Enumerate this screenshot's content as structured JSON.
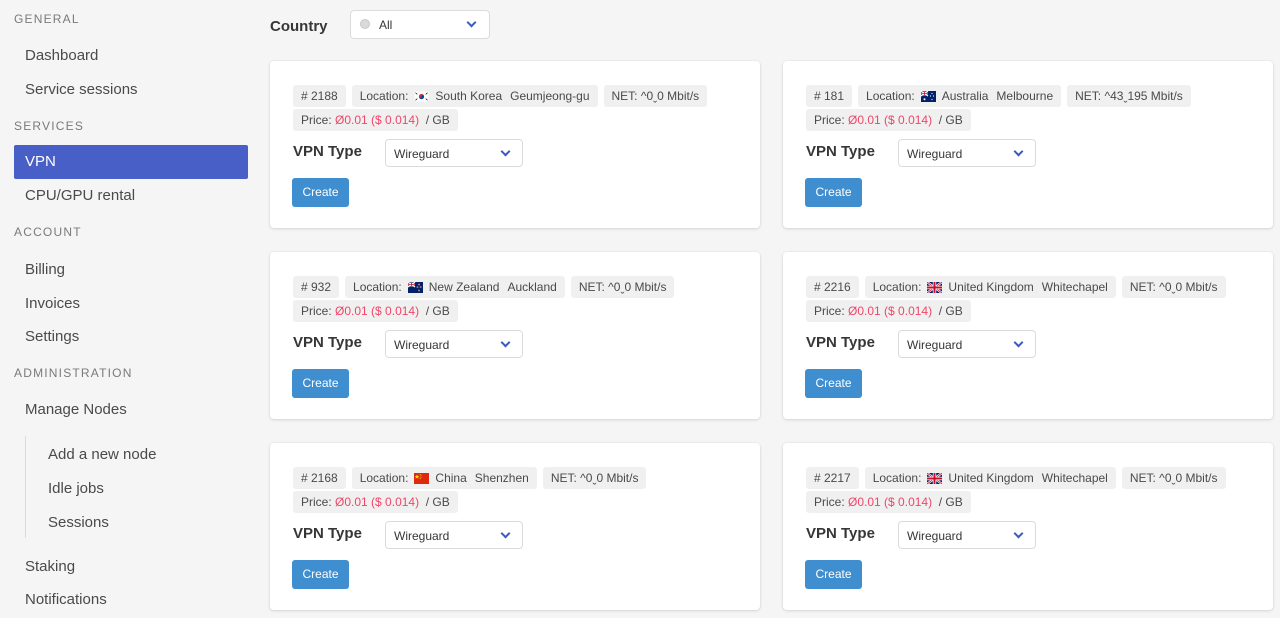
{
  "sidebar": {
    "sections": [
      {
        "label": "GENERAL"
      },
      {
        "label": "SERVICES"
      },
      {
        "label": "ACCOUNT"
      },
      {
        "label": "ADMINISTRATION"
      }
    ],
    "items": [
      {
        "label": "Dashboard"
      },
      {
        "label": "Service sessions"
      },
      {
        "label": "VPN"
      },
      {
        "label": "CPU/GPU rental"
      },
      {
        "label": "Billing"
      },
      {
        "label": "Invoices"
      },
      {
        "label": "Settings"
      },
      {
        "label": "Manage Nodes"
      },
      {
        "label": "Staking"
      },
      {
        "label": "Notifications"
      }
    ],
    "sub_items": [
      {
        "label": "Add a new node"
      },
      {
        "label": "Idle jobs"
      },
      {
        "label": "Sessions"
      }
    ],
    "active_color": "#485fc7"
  },
  "filter": {
    "country_label": "Country",
    "country_value": "All"
  },
  "cards": [
    {
      "id": "# 2188",
      "location_label": "Location:",
      "flag": "kr-flag",
      "country": "South Korea",
      "city": "Geumjeong-gu",
      "net": "NET: ^0ˬ0 Mbit/s",
      "price_label": "Price:",
      "price_value": "Ø0.01 ($ 0.014)",
      "price_unit": "/ GB",
      "vpn_type_label": "VPN Type",
      "vpn_type_value": "Wireguard",
      "create_label": "Create"
    },
    {
      "id": "# 181",
      "location_label": "Location:",
      "flag": "au-flag",
      "country": "Australia",
      "city": "Melbourne",
      "net": "NET: ^43ˬ195 Mbit/s",
      "price_label": "Price:",
      "price_value": "Ø0.01 ($ 0.014)",
      "price_unit": "/ GB",
      "vpn_type_label": "VPN Type",
      "vpn_type_value": "Wireguard",
      "create_label": "Create"
    },
    {
      "id": "# 932",
      "location_label": "Location:",
      "flag": "nz-flag",
      "country": "New Zealand",
      "city": "Auckland",
      "net": "NET: ^0ˬ0 Mbit/s",
      "price_label": "Price:",
      "price_value": "Ø0.01 ($ 0.014)",
      "price_unit": "/ GB",
      "vpn_type_label": "VPN Type",
      "vpn_type_value": "Wireguard",
      "create_label": "Create"
    },
    {
      "id": "# 2216",
      "location_label": "Location:",
      "flag": "gb-flag",
      "country": "United Kingdom",
      "city": "Whitechapel",
      "net": "NET: ^0ˬ0 Mbit/s",
      "price_label": "Price:",
      "price_value": "Ø0.01 ($ 0.014)",
      "price_unit": "/ GB",
      "vpn_type_label": "VPN Type",
      "vpn_type_value": "Wireguard",
      "create_label": "Create"
    },
    {
      "id": "# 2168",
      "location_label": "Location:",
      "flag": "cn-flag",
      "country": "China",
      "city": "Shenzhen",
      "net": "NET: ^0ˬ0 Mbit/s",
      "price_label": "Price:",
      "price_value": "Ø0.01 ($ 0.014)",
      "price_unit": "/ GB",
      "vpn_type_label": "VPN Type",
      "vpn_type_value": "Wireguard",
      "create_label": "Create"
    },
    {
      "id": "# 2217",
      "location_label": "Location:",
      "flag": "gb-flag",
      "country": "United Kingdom",
      "city": "Whitechapel",
      "net": "NET: ^0ˬ0 Mbit/s",
      "price_label": "Price:",
      "price_value": "Ø0.01 ($ 0.014)",
      "price_unit": "/ GB",
      "vpn_type_label": "VPN Type",
      "vpn_type_value": "Wireguard",
      "create_label": "Create"
    }
  ],
  "colors": {
    "button": "#3e8ed0",
    "price": "#f14668"
  }
}
